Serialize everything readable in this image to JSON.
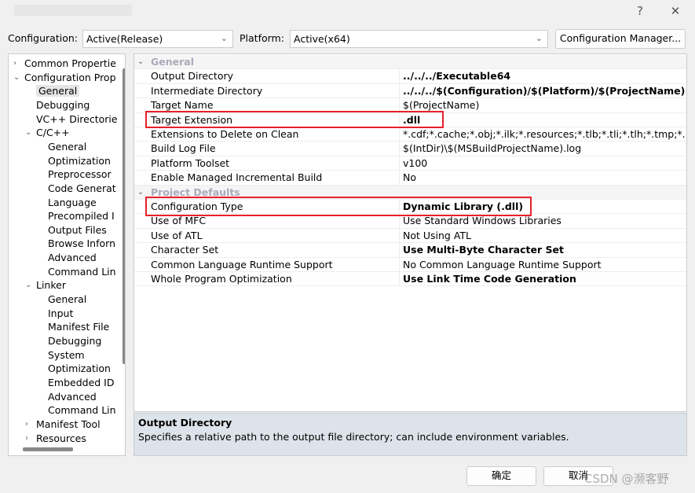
{
  "window": {
    "help": "?",
    "close": "✕"
  },
  "toolbar": {
    "configuration_label": "Configuration:",
    "configuration_value": "Active(Release)",
    "platform_label": "Platform:",
    "platform_value": "Active(x64)",
    "config_manager": "Configuration Manager..."
  },
  "tree": [
    {
      "label": "Common Propertie",
      "level": 0,
      "arrow": "›"
    },
    {
      "label": "Configuration Prop",
      "level": 0,
      "arrow": "⌄"
    },
    {
      "label": "General",
      "level": 1,
      "selected": true
    },
    {
      "label": "Debugging",
      "level": 1
    },
    {
      "label": "VC++ Directorie",
      "level": 1
    },
    {
      "label": "C/C++",
      "level": 1,
      "arrow": "⌄"
    },
    {
      "label": "General",
      "level": 2
    },
    {
      "label": "Optimization",
      "level": 2
    },
    {
      "label": "Preprocessor",
      "level": 2
    },
    {
      "label": "Code Generat",
      "level": 2
    },
    {
      "label": "Language",
      "level": 2
    },
    {
      "label": "Precompiled I",
      "level": 2
    },
    {
      "label": "Output Files",
      "level": 2
    },
    {
      "label": "Browse Inforn",
      "level": 2
    },
    {
      "label": "Advanced",
      "level": 2
    },
    {
      "label": "Command Lin",
      "level": 2
    },
    {
      "label": "Linker",
      "level": 1,
      "arrow": "⌄"
    },
    {
      "label": "General",
      "level": 2
    },
    {
      "label": "Input",
      "level": 2
    },
    {
      "label": "Manifest File",
      "level": 2
    },
    {
      "label": "Debugging",
      "level": 2
    },
    {
      "label": "System",
      "level": 2
    },
    {
      "label": "Optimization",
      "level": 2
    },
    {
      "label": "Embedded ID",
      "level": 2
    },
    {
      "label": "Advanced",
      "level": 2
    },
    {
      "label": "Command Lin",
      "level": 2
    },
    {
      "label": "Manifest Tool",
      "level": 1,
      "arrow": "›"
    },
    {
      "label": "Resources",
      "level": 1,
      "arrow": "›"
    }
  ],
  "grid": [
    {
      "category": "General"
    },
    {
      "key": "Output Directory",
      "value": "../../../Executable64",
      "bold": true
    },
    {
      "key": "Intermediate Directory",
      "value": "../../../$(Configuration)/$(Platform)/$(ProjectName)",
      "bold": true
    },
    {
      "key": "Target Name",
      "value": "$(ProjectName)"
    },
    {
      "key": "Target Extension",
      "value": ".dll",
      "bold": true,
      "highlight": true
    },
    {
      "key": "Extensions to Delete on Clean",
      "value": "*.cdf;*.cache;*.obj;*.ilk;*.resources;*.tlb;*.tli;*.tlh;*.tmp;*.rsp;*.pgc;*.pgd"
    },
    {
      "key": "Build Log File",
      "value": "$(IntDir)\\$(MSBuildProjectName).log"
    },
    {
      "key": "Platform Toolset",
      "value": "v100"
    },
    {
      "key": "Enable Managed Incremental Build",
      "value": "No"
    },
    {
      "category": "Project Defaults"
    },
    {
      "key": "Configuration Type",
      "value": "Dynamic Library (.dll)",
      "bold": true,
      "highlight": true
    },
    {
      "key": "Use of MFC",
      "value": "Use Standard Windows Libraries"
    },
    {
      "key": "Use of ATL",
      "value": "Not Using ATL"
    },
    {
      "key": "Character Set",
      "value": "Use Multi-Byte Character Set",
      "bold": true
    },
    {
      "key": "Common Language Runtime Support",
      "value": "No Common Language Runtime Support"
    },
    {
      "key": "Whole Program Optimization",
      "value": "Use Link Time Code Generation",
      "bold": true
    }
  ],
  "description": {
    "title": "Output Directory",
    "text": "Specifies a relative path to the output file directory; can include environment variables."
  },
  "buttons": {
    "ok": "确定",
    "cancel": "取消"
  },
  "watermark": "CSDN @濒客野",
  "colors": {
    "highlight_box": "#e8202a",
    "selection": "#e5e5e5"
  }
}
